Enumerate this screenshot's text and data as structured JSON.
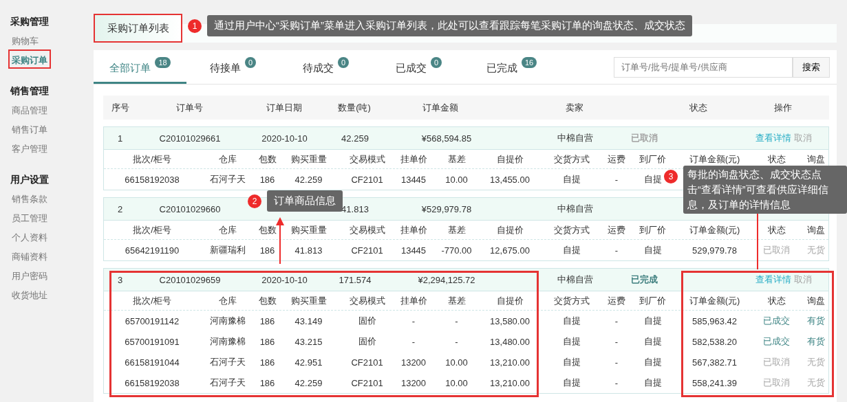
{
  "sidebar": {
    "sections": [
      {
        "title": "采购管理",
        "items": [
          {
            "label": "购物车",
            "selected": false
          },
          {
            "label": "采购订单",
            "selected": true
          }
        ]
      },
      {
        "title": "销售管理",
        "items": [
          {
            "label": "商品管理",
            "selected": false
          },
          {
            "label": "销售订单",
            "selected": false
          },
          {
            "label": "客户管理",
            "selected": false
          }
        ]
      },
      {
        "title": "用户设置",
        "items": [
          {
            "label": "销售条款",
            "selected": false
          },
          {
            "label": "员工管理",
            "selected": false
          },
          {
            "label": "个人资料",
            "selected": false
          },
          {
            "label": "商铺资料",
            "selected": false
          },
          {
            "label": "用户密码",
            "selected": false
          },
          {
            "label": "收货地址",
            "selected": false
          }
        ]
      }
    ]
  },
  "page_title": "采购订单列表",
  "tabs": [
    {
      "label": "全部订单",
      "count": "18",
      "selected": true
    },
    {
      "label": "待接单",
      "count": "0",
      "selected": false
    },
    {
      "label": "待成交",
      "count": "0",
      "selected": false
    },
    {
      "label": "已成交",
      "count": "0",
      "selected": false
    },
    {
      "label": "已完成",
      "count": "16",
      "selected": false
    }
  ],
  "search": {
    "placeholder": "订单号/批号/提单号/供应商",
    "button": "搜索"
  },
  "columns": [
    "序号",
    "订单号",
    "订单日期",
    "数量(吨)",
    "订单金额",
    "卖家",
    "状态",
    "操作"
  ],
  "orders": [
    {
      "index": "1",
      "order_no": "C20101029661",
      "date": "2020-10-10",
      "quantity": "42.259",
      "amount": "¥568,594.85",
      "seller": "中棉自营",
      "status": "已取消",
      "completed": false,
      "actions": [
        {
          "label": "查看详情",
          "disabled": false
        },
        {
          "label": "取消",
          "disabled": true
        }
      ],
      "item_columns": [
        "批次/柜号",
        "仓库",
        "包数",
        "购买重量",
        "交易模式",
        "挂单价",
        "基差",
        "自提价",
        "交货方式",
        "运费",
        "到厂价",
        "订单金额(元)",
        "状态",
        "询盘"
      ],
      "items": [
        {
          "batch": "66158192038",
          "warehouse": "石河子天",
          "packages": "186",
          "weight": "42.259",
          "mode": "CF2101",
          "list_price": "13445",
          "basis": "10.00",
          "pickup_price": "13,455.00",
          "delivery": "自提",
          "freight": "-",
          "factory_price": "自提"
        }
      ]
    },
    {
      "index": "2",
      "order_no": "C20101029660",
      "quantity": "41.813",
      "amount": "¥529,979.78",
      "seller": "中棉自营",
      "item_columns": [
        "批次/柜号",
        "仓库",
        "包数",
        "购买重量",
        "交易模式",
        "挂单价",
        "基差",
        "自提价",
        "交货方式",
        "运费",
        "到厂价",
        "订单金额(元)",
        "状态",
        "询盘"
      ],
      "items": [
        {
          "batch": "65642191190",
          "warehouse": "新疆瑞利",
          "packages": "186",
          "weight": "41.813",
          "mode": "CF2101",
          "list_price": "13445",
          "basis": "-770.00",
          "pickup_price": "12,675.00",
          "delivery": "自提",
          "freight": "-",
          "factory_price": "自提",
          "amount": "529,979.78",
          "status": "已取消",
          "done": false,
          "inquiry": "无货",
          "in_stock": false
        }
      ]
    },
    {
      "index": "3",
      "order_no": "C20101029659",
      "date": "2020-10-10",
      "quantity": "171.574",
      "amount": "¥2,294,125.72",
      "seller": "中棉自营",
      "status": "已完成",
      "completed": true,
      "actions": [
        {
          "label": "查看详情",
          "disabled": false
        },
        {
          "label": "取消",
          "disabled": true
        }
      ],
      "item_columns": [
        "批次/柜号",
        "仓库",
        "包数",
        "购买重量",
        "交易模式",
        "挂单价",
        "基差",
        "自提价",
        "交货方式",
        "运费",
        "到厂价",
        "订单金额(元)",
        "状态",
        "询盘"
      ],
      "items": [
        {
          "batch": "65700191142",
          "warehouse": "河南豫棉",
          "packages": "186",
          "weight": "43.149",
          "mode": "固价",
          "list_price": "-",
          "basis": "-",
          "pickup_price": "13,580.00",
          "delivery": "自提",
          "freight": "-",
          "factory_price": "自提",
          "amount": "585,963.42",
          "status": "已成交",
          "done": true,
          "inquiry": "有货",
          "in_stock": true
        },
        {
          "batch": "65700191091",
          "warehouse": "河南豫棉",
          "packages": "186",
          "weight": "43.215",
          "mode": "固价",
          "list_price": "-",
          "basis": "-",
          "pickup_price": "13,480.00",
          "delivery": "自提",
          "freight": "-",
          "factory_price": "自提",
          "amount": "582,538.20",
          "status": "已成交",
          "done": true,
          "inquiry": "有货",
          "in_stock": true
        },
        {
          "batch": "66158191044",
          "warehouse": "石河子天",
          "packages": "186",
          "weight": "42.951",
          "mode": "CF2101",
          "list_price": "13200",
          "basis": "10.00",
          "pickup_price": "13,210.00",
          "delivery": "自提",
          "freight": "-",
          "factory_price": "自提",
          "amount": "567,382.71",
          "status": "已取消",
          "done": false,
          "inquiry": "无货",
          "in_stock": false
        },
        {
          "batch": "66158192038",
          "warehouse": "石河子天",
          "packages": "186",
          "weight": "42.259",
          "mode": "CF2101",
          "list_price": "13200",
          "basis": "10.00",
          "pickup_price": "13,210.00",
          "delivery": "自提",
          "freight": "-",
          "factory_price": "自提",
          "amount": "558,241.39",
          "status": "已取消",
          "done": false,
          "inquiry": "无货",
          "in_stock": false
        }
      ]
    }
  ],
  "callouts": [
    {
      "number": "1",
      "text": "通过用户中心“采购订单”菜单进入采购订单列表，此处可以查看跟踪每笔采购订单的询盘状态、成交状态"
    },
    {
      "number": "2",
      "text": "订单商品信息"
    },
    {
      "number": "3",
      "text": "每批的询盘状态、成交状态点击“查看详情”可查看供应详细信息，及订单的详情信息"
    }
  ]
}
